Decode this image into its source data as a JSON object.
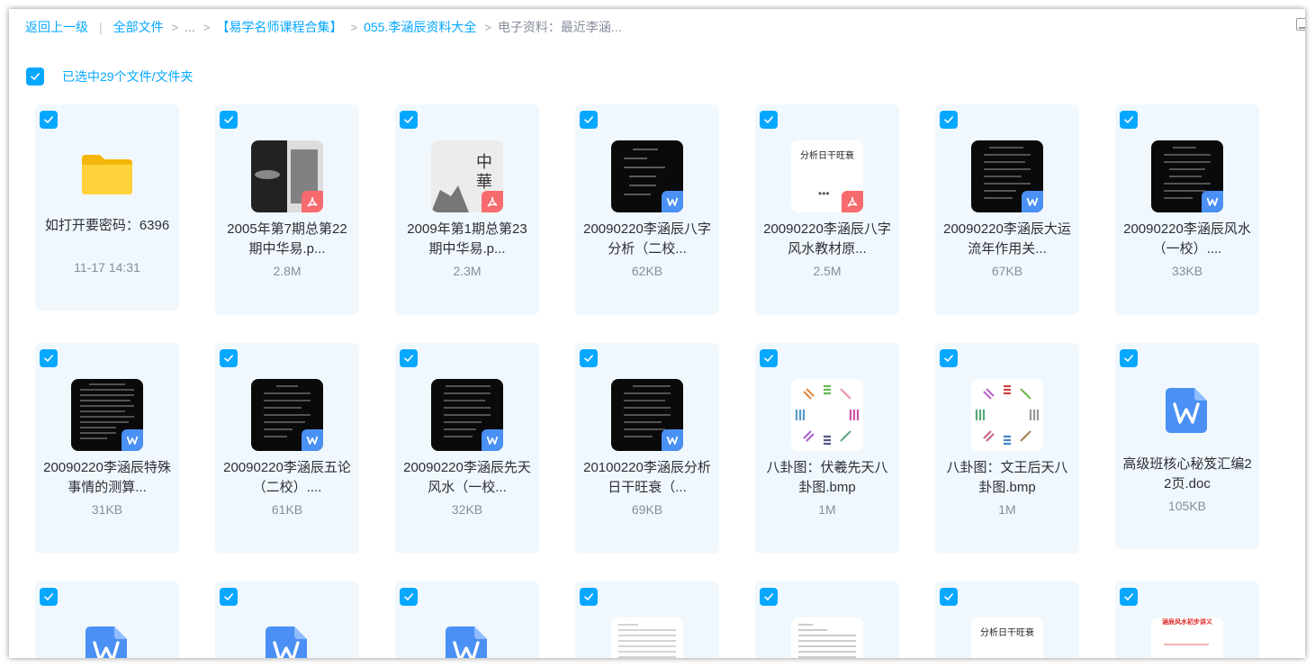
{
  "breadcrumb": {
    "back": "返回上一级",
    "all_files": "全部文件",
    "ellipsis": "...",
    "folder1": "【易学名师课程合集】",
    "folder2": "055.李涵辰资料大全",
    "current": "电子资料：最近李涵..."
  },
  "selection": {
    "label": "已选中29个文件/文件夹"
  },
  "files": [
    {
      "name": "如打开要密码：6396",
      "meta": "11-17 14:31",
      "type": "folder"
    },
    {
      "name": "2005年第7期总第22期中华易.p...",
      "meta": "2.8M",
      "type": "pdf"
    },
    {
      "name": "2009年第1期总第23期中华易.p...",
      "meta": "2.3M",
      "type": "pdf"
    },
    {
      "name": "20090220李涵辰八字分析（二校...",
      "meta": "62KB",
      "type": "doc"
    },
    {
      "name": "20090220李涵辰八字风水教材原...",
      "meta": "2.5M",
      "type": "pdf"
    },
    {
      "name": "20090220李涵辰大运流年作用关...",
      "meta": "67KB",
      "type": "doc"
    },
    {
      "name": "20090220李涵辰风水（一校）....",
      "meta": "33KB",
      "type": "doc"
    },
    {
      "name": "20090220李涵辰特殊事情的测算...",
      "meta": "31KB",
      "type": "doc"
    },
    {
      "name": "20090220李涵辰五论（二校）....",
      "meta": "61KB",
      "type": "doc"
    },
    {
      "name": "20090220李涵辰先天风水（一校...",
      "meta": "32KB",
      "type": "doc"
    },
    {
      "name": "20100220李涵辰分析日干旺衰（...",
      "meta": "69KB",
      "type": "doc"
    },
    {
      "name": "八卦图：伏羲先天八卦图.bmp",
      "meta": "1M",
      "type": "image"
    },
    {
      "name": "八卦图：文王后天八卦图.bmp",
      "meta": "1M",
      "type": "image"
    },
    {
      "name": "高级班核心秘笈汇编22页.doc",
      "meta": "105KB",
      "type": "doc-icon"
    },
    {
      "name": "",
      "meta": "",
      "type": "doc-icon"
    },
    {
      "name": "",
      "meta": "",
      "type": "doc-icon"
    },
    {
      "name": "",
      "meta": "",
      "type": "doc-icon"
    },
    {
      "name": "",
      "meta": "",
      "type": "doc"
    },
    {
      "name": "",
      "meta": "",
      "type": "doc"
    },
    {
      "name": "",
      "meta": "",
      "type": "doc"
    },
    {
      "name": "",
      "meta": "",
      "type": "doc"
    }
  ],
  "thumb_text": {
    "pdf_cover": "分析日干旺衰",
    "doc_cover": "分析日干旺衰",
    "red_title": "涵辰风水初步讲义"
  },
  "colors": {
    "accent": "#06a7ff",
    "card_bg": "#f1f8fd",
    "pdf_badge": "#f76b6f",
    "doc_badge": "#4a90f5"
  }
}
